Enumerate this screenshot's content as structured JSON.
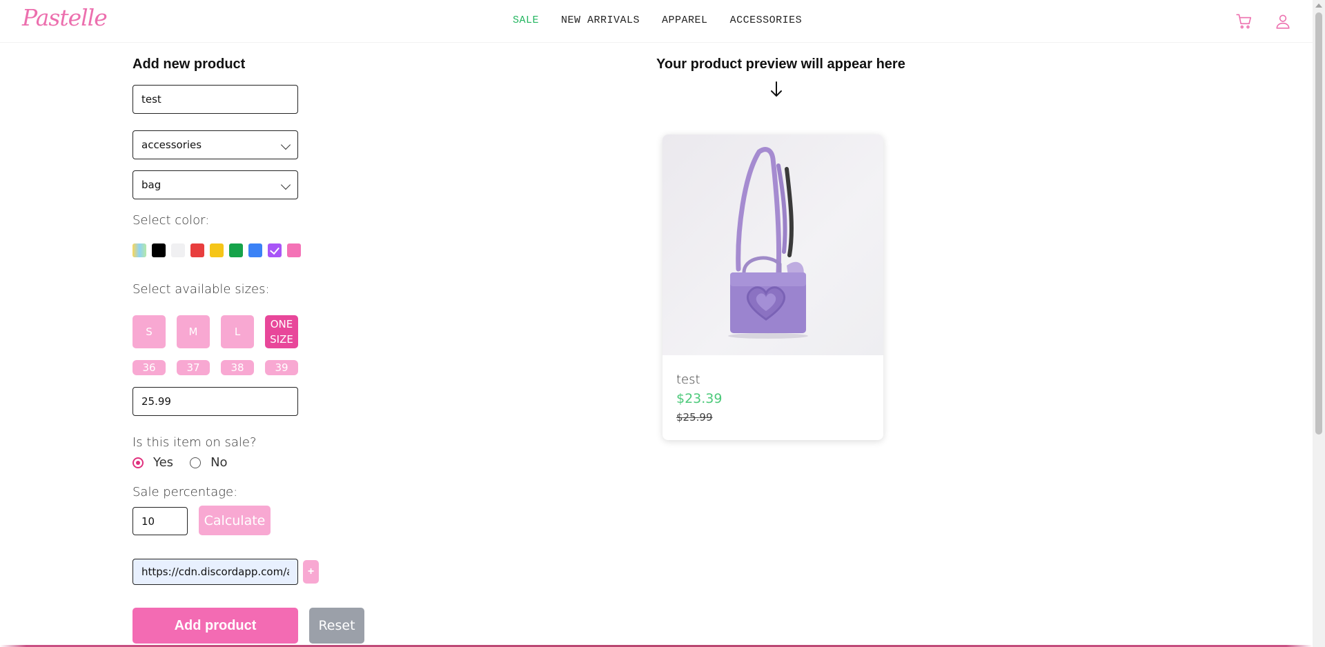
{
  "header": {
    "logo": "Pastelle",
    "nav": [
      "SALE",
      "NEW ARRIVALS",
      "APPAREL",
      "ACCESSORIES"
    ],
    "active_nav_color": "#22b55f",
    "icons": [
      "cart-icon",
      "user-icon"
    ]
  },
  "form": {
    "title": "Add new product",
    "name_value": "test",
    "category_value": "accessories",
    "subcategory_value": "bag",
    "color_label": "Select color:",
    "colors": [
      {
        "name": "multicolor",
        "hex": "gradient",
        "checked": false
      },
      {
        "name": "black",
        "hex": "#000000",
        "checked": false
      },
      {
        "name": "white",
        "hex": "#f0f0f2",
        "checked": false
      },
      {
        "name": "red",
        "hex": "#e83e3e",
        "checked": false
      },
      {
        "name": "yellow",
        "hex": "#f5c518",
        "checked": false
      },
      {
        "name": "green",
        "hex": "#16a34a",
        "checked": false
      },
      {
        "name": "blue",
        "hex": "#3b82f6",
        "checked": false
      },
      {
        "name": "purple",
        "hex": "#a855f7",
        "checked": true
      },
      {
        "name": "pink",
        "hex": "#f472b6",
        "checked": false
      }
    ],
    "sizes_label": "Select available sizes:",
    "sizes": [
      "S",
      "M",
      "L",
      "ONE SIZE"
    ],
    "selected_size": "ONE SIZE",
    "shoe_sizes": [
      "36",
      "37",
      "38",
      "39"
    ],
    "price_value": "25.99",
    "sale_question": "Is this item on sale?",
    "sale_yes": "Yes",
    "sale_no": "No",
    "sale_selected": "Yes",
    "sale_pct_label": "Sale percentage:",
    "sale_pct_value": "10",
    "calculate_label": "Calculate",
    "image_url_value": "https://cdn.discordapp.com/at",
    "add_image_label": "+",
    "add_product_label": "Add product",
    "reset_label": "Reset"
  },
  "preview": {
    "title": "Your product preview will appear here",
    "product_name": "test",
    "sale_price": "$23.39",
    "original_price": "$25.99"
  },
  "colors": {
    "accent_pink": "#f36bb3",
    "light_pink": "#f8a8d2",
    "sale_green": "#4cc97a",
    "reset_gray": "#9ba0a9"
  }
}
